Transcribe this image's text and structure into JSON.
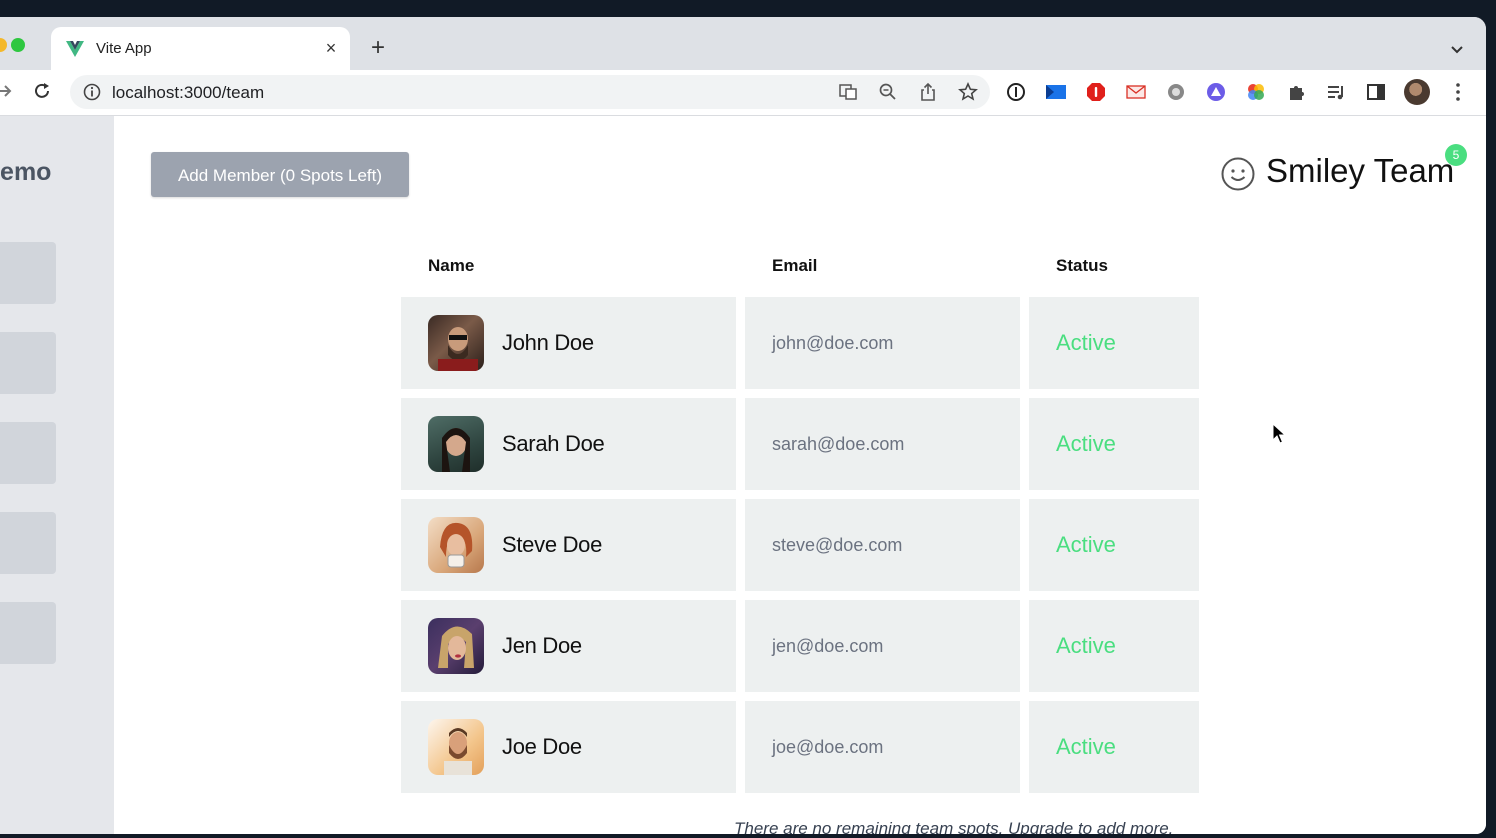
{
  "browser": {
    "tab_title": "Vite App",
    "tab_close": "×",
    "new_tab": "+",
    "url": "localhost:3000/team",
    "omnibox_icons": [
      "translate-icon",
      "zoom-out-icon",
      "share-icon",
      "bookmark-star-icon"
    ],
    "extension_icons": [
      "password-manager-icon",
      "extension-blue-icon",
      "adblock-icon",
      "mail-extension-icon",
      "film-extension-icon",
      "triangle-extension-icon",
      "color-wheel-icon",
      "extensions-puzzle-icon",
      "media-queue-icon",
      "side-panel-icon",
      "profile-avatar"
    ]
  },
  "sidebar": {
    "title": "Demo",
    "blocks": 5
  },
  "header": {
    "add_button": "Add Member (0 Spots Left)",
    "team_name": "Smiley Team",
    "team_icon": "smiley-face-icon",
    "notification_count": "5"
  },
  "table": {
    "columns": [
      "Name",
      "Email",
      "Status"
    ],
    "rows": [
      {
        "name": "John Doe",
        "email": "john@doe.com",
        "status": "Active"
      },
      {
        "name": "Sarah Doe",
        "email": "sarah@doe.com",
        "status": "Active"
      },
      {
        "name": "Steve Doe",
        "email": "steve@doe.com",
        "status": "Active"
      },
      {
        "name": "Jen Doe",
        "email": "jen@doe.com",
        "status": "Active"
      },
      {
        "name": "Joe Doe",
        "email": "joe@doe.com",
        "status": "Active"
      }
    ]
  },
  "footer": {
    "note": "There are no remaining team spots. Upgrade to add more."
  },
  "colors": {
    "status_active": "#4ade80",
    "button_bg": "#9ca3af",
    "row_bg": "#edf0f0",
    "sidebar_bg": "#e5e7eb"
  }
}
